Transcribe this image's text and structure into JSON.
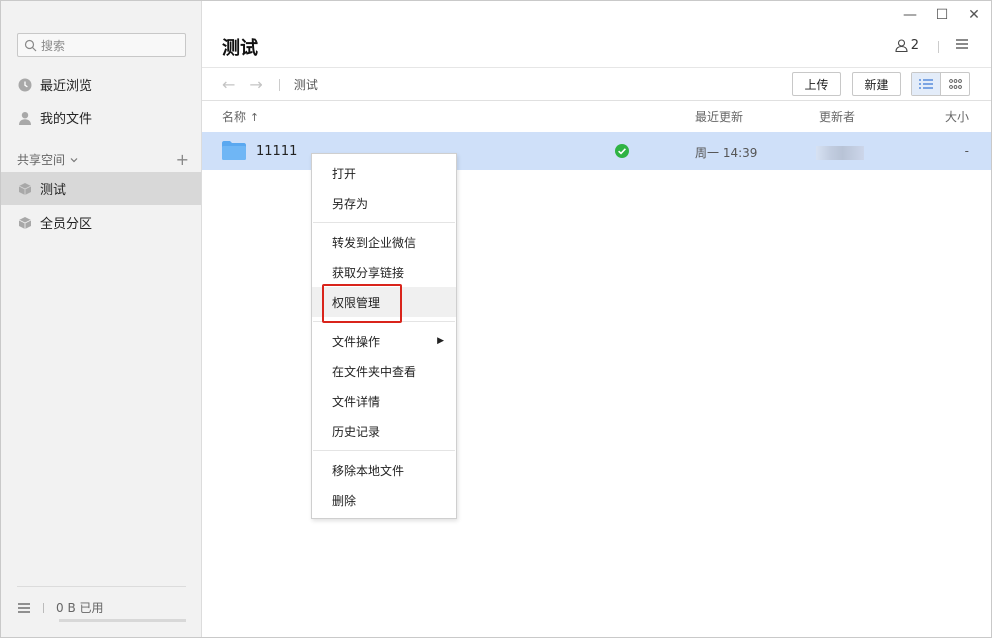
{
  "sidebar": {
    "search_placeholder": "搜索",
    "items": [
      {
        "label": "最近浏览",
        "icon": "clock-icon"
      },
      {
        "label": "我的文件",
        "icon": "person-icon"
      }
    ],
    "section_title": "共享空间",
    "spaces": [
      {
        "label": "测试",
        "icon": "box-icon",
        "active": true
      },
      {
        "label": "全员分区",
        "icon": "box-icon",
        "active": false
      }
    ],
    "footer": {
      "usage": "0 B 已用"
    }
  },
  "window": {
    "minimize": "—",
    "maximize": "☐",
    "close": "✕"
  },
  "header": {
    "title": "测试",
    "member_count": "2"
  },
  "toolbar": {
    "back": "←",
    "forward": "→",
    "breadcrumb": "测试",
    "upload_label": "上传",
    "new_label": "新建"
  },
  "columns": {
    "name": "名称",
    "sort_indicator": "↑",
    "updated": "最近更新",
    "updater": "更新者",
    "size": "大小"
  },
  "rows": [
    {
      "name": "11111",
      "updated": "周一 14:39",
      "size": "-",
      "status": "synced"
    }
  ],
  "context_menu": {
    "items": [
      {
        "label": "打开"
      },
      {
        "label": "另存为"
      },
      {
        "label": "转发到企业微信"
      },
      {
        "label": "获取分享链接"
      },
      {
        "label": "权限管理",
        "highlighted": true
      },
      {
        "label": "文件操作",
        "has_submenu": true
      },
      {
        "label": "在文件夹中查看"
      },
      {
        "label": "文件详情"
      },
      {
        "label": "历史记录"
      },
      {
        "label": "移除本地文件"
      },
      {
        "label": "删除"
      }
    ],
    "submenu_arrow": "▶"
  },
  "colors": {
    "selection": "#cfe0f9",
    "folder": "#5aa8f0",
    "success": "#2fb344",
    "highlight_box": "#d9241b"
  }
}
